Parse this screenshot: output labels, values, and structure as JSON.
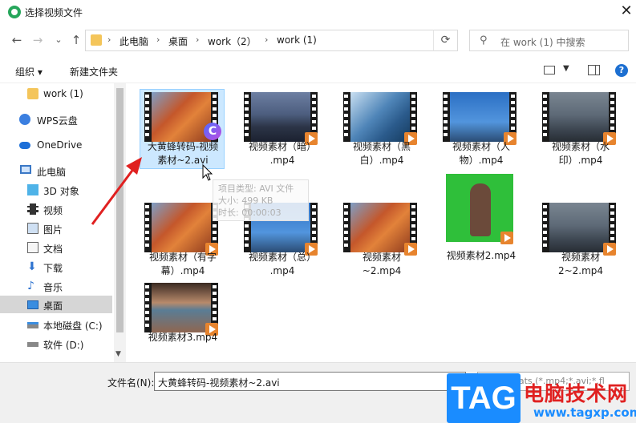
{
  "window": {
    "title": "选择视频文件",
    "close": "✕"
  },
  "nav": {
    "back": "←",
    "forward": "→",
    "recent": "⌄",
    "up": "↑"
  },
  "breadcrumb": [
    "此电脑",
    "桌面",
    "work（2）",
    "work (1)"
  ],
  "search": {
    "placeholder": "在 work (1) 中搜索"
  },
  "toolbar": {
    "organize": "组织 ▾",
    "new_folder": "新建文件夹",
    "help": "?"
  },
  "sidebar": {
    "items": [
      {
        "label": "work (1)",
        "icon": "folder-icon"
      },
      {
        "label": "WPS云盘",
        "icon": "cloud-icon"
      },
      {
        "label": "OneDrive",
        "icon": "onedrive-icon"
      },
      {
        "label": "此电脑",
        "icon": "computer-icon"
      },
      {
        "label": "3D 对象",
        "icon": "3d-objects-icon"
      },
      {
        "label": "视频",
        "icon": "video-folder-icon"
      },
      {
        "label": "图片",
        "icon": "pictures-icon"
      },
      {
        "label": "文档",
        "icon": "documents-icon"
      },
      {
        "label": "下载",
        "icon": "download-icon"
      },
      {
        "label": "音乐",
        "icon": "music-icon"
      },
      {
        "label": "桌面",
        "icon": "desktop-icon",
        "selected": true
      },
      {
        "label": "本地磁盘 (C:)",
        "icon": "drive-c-icon"
      },
      {
        "label": "软件 (D:)",
        "icon": "drive-d-icon"
      }
    ]
  },
  "files": [
    {
      "name_line1": "大黄蜂转码-视频",
      "name_line2": "素材~2.avi",
      "thumb": "autumn-leaves",
      "selected": true
    },
    {
      "name_line1": "视频素材（暗）",
      "name_line2": ".mp4",
      "thumb": "city-dusk"
    },
    {
      "name_line1": "视频素材（黑",
      "name_line2": "白）.mp4",
      "thumb": "frosted-leaves"
    },
    {
      "name_line1": "视频素材（人",
      "name_line2": "物）.mp4",
      "thumb": "person-sky"
    },
    {
      "name_line1": "视频素材（水",
      "name_line2": "印）.mp4",
      "thumb": "city-aerial"
    },
    {
      "name_line1": "视频素材（有字",
      "name_line2": "幕）.mp4",
      "thumb": "autumn-leaves"
    },
    {
      "name_line1": "视频素材（总）",
      "name_line2": ".mp4",
      "thumb": "person-sky"
    },
    {
      "name_line1": "视频素材",
      "name_line2": "~2.mp4",
      "thumb": "autumn-leaves"
    },
    {
      "name_line1": "视频素材2.mp4",
      "name_line2": "",
      "thumb": "green-screen"
    },
    {
      "name_line1": "视频素材",
      "name_line2": "2~2.mp4",
      "thumb": "city-aerial"
    },
    {
      "name_line1": "视频素材3.mp4",
      "name_line2": "",
      "thumb": "glasses-face"
    }
  ],
  "tooltip": {
    "line1": "项目类型: AVI 文件",
    "line2": "大小: 499 KB",
    "line3": "时长: 00:00:03"
  },
  "bottom": {
    "filename_label": "文件名(N):",
    "filename_value": "大黄蜂转码-视频素材~2.avi",
    "filetype": "All Formats (*.mp4;*.avi;*.fl"
  },
  "watermark": {
    "tag": "TAG",
    "cn": "电脑技术网",
    "url": "www.tagxp.com"
  },
  "colors": {
    "accent": "#1a8cff",
    "arrow": "#e02020",
    "selected_tile": "#cce8ff"
  }
}
